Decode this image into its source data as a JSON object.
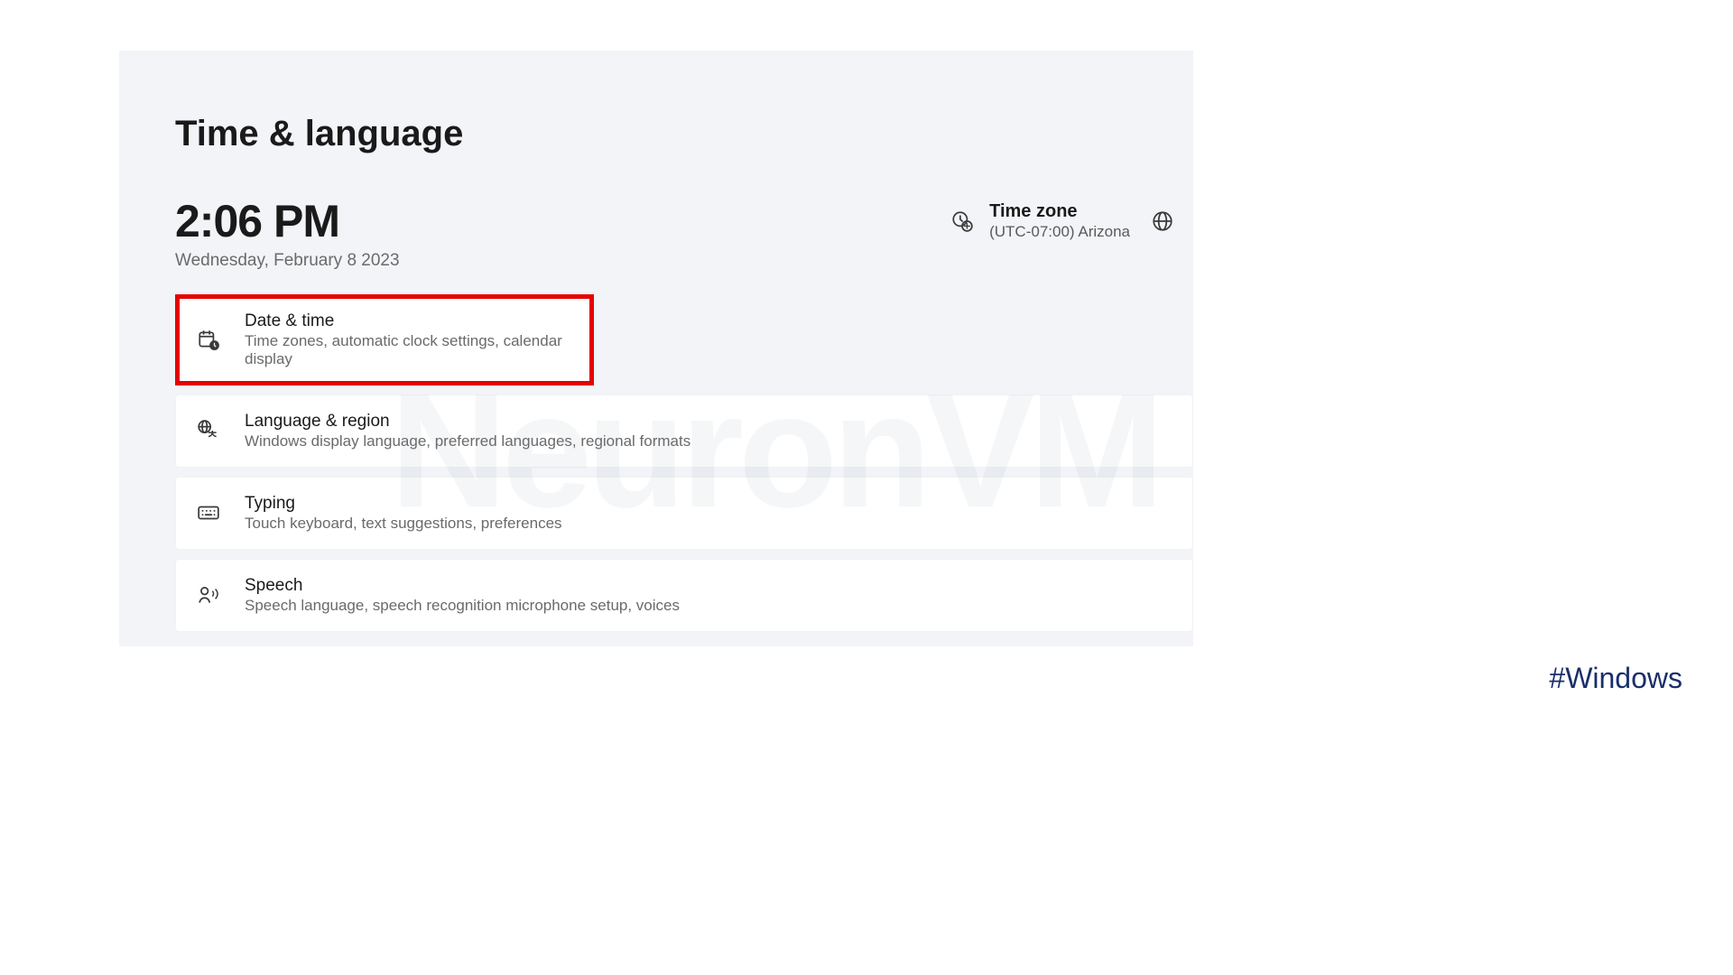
{
  "page": {
    "title": "Time & language"
  },
  "clock": {
    "time": "2:06 PM",
    "date": "Wednesday, February 8  2023"
  },
  "timezone": {
    "label": "Time zone",
    "value": "(UTC-07:00) Arizona"
  },
  "items": [
    {
      "title": "Date & time",
      "subtitle": "Time zones, automatic clock settings, calendar display",
      "highlighted": true
    },
    {
      "title": "Language & region",
      "subtitle": "Windows display language, preferred languages, regional formats",
      "highlighted": false
    },
    {
      "title": "Typing",
      "subtitle": "Touch keyboard, text suggestions, preferences",
      "highlighted": false
    },
    {
      "title": "Speech",
      "subtitle": "Speech language, speech recognition microphone setup, voices",
      "highlighted": false
    }
  ],
  "watermark": "NeuronVM",
  "hashtag": "#Windows"
}
